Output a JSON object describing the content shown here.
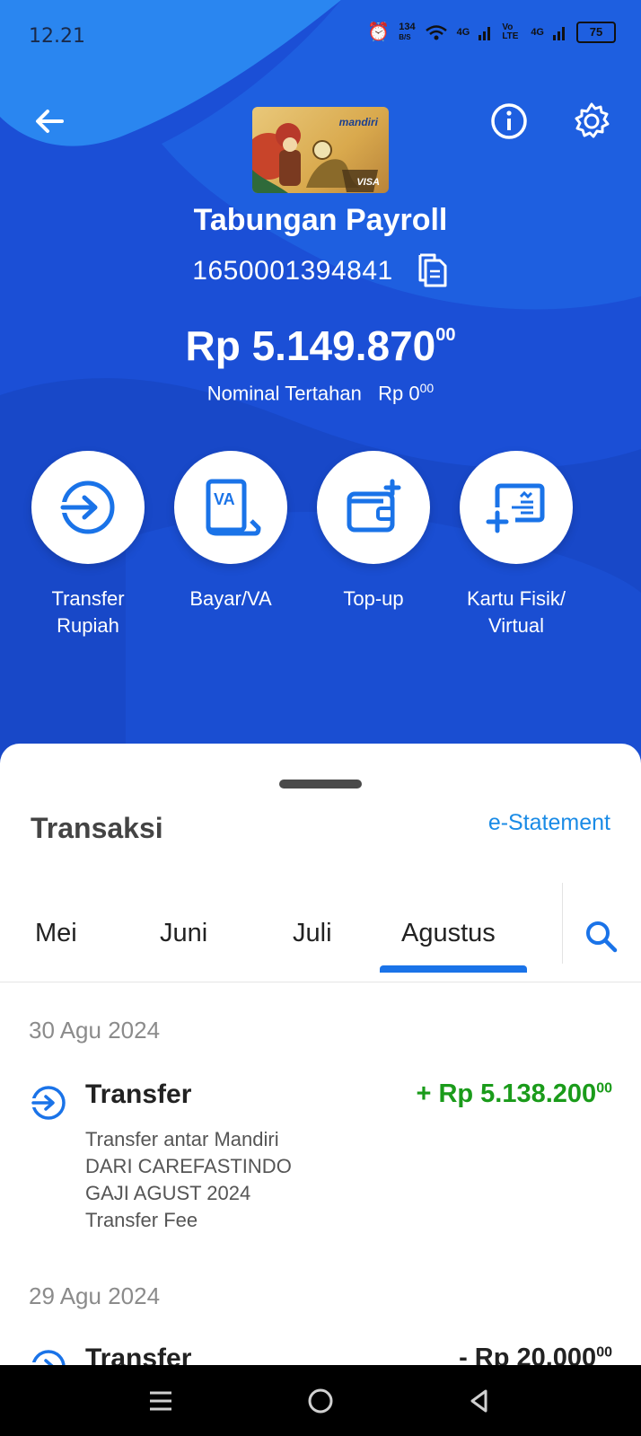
{
  "status_bar": {
    "time": "12.21",
    "data_speed": "134",
    "data_unit": "B/S",
    "net1": "4G",
    "volte": "Vo LTE",
    "net2": "4G",
    "battery": "75"
  },
  "header": {
    "card_brand": "mandiri",
    "card_network": "VISA",
    "account_name": "Tabungan Payroll",
    "account_number": "1650001394841",
    "balance_main": "Rp 5.149.870",
    "balance_cents": "00",
    "held_label": "Nominal Tertahan",
    "held_amount": "Rp 0",
    "held_cents": "00"
  },
  "actions": [
    {
      "label_line1": "Transfer",
      "label_line2": "Rupiah",
      "icon": "transfer-icon"
    },
    {
      "label_line1": "Bayar/VA",
      "label_line2": "",
      "icon": "va-icon"
    },
    {
      "label_line1": "Top-up",
      "label_line2": "",
      "icon": "wallet-plus-icon"
    },
    {
      "label_line1": "Kartu Fisik/",
      "label_line2": "Virtual",
      "icon": "card-plus-icon"
    }
  ],
  "transactions": {
    "title": "Transaksi",
    "estatement": "e-Statement",
    "tabs": [
      "Mei",
      "Juni",
      "Juli",
      "Agustus"
    ],
    "active_tab": "Agustus",
    "groups": [
      {
        "date": "30 Agu 2024",
        "items": [
          {
            "title": "Transfer",
            "amount": "+ Rp 5.138.200",
            "cents": "00",
            "desc": [
              "Transfer antar Mandiri",
              "DARI CAREFASTINDO",
              "GAJI AGUST 2024",
              "Transfer Fee"
            ]
          }
        ]
      },
      {
        "date": "29 Agu 2024",
        "items": [
          {
            "title": "Transfer",
            "amount": "- Rp 20.000",
            "cents": "00",
            "desc": []
          }
        ]
      }
    ]
  },
  "colors": {
    "primary": "#1b4fd6",
    "accent": "#1a73e8",
    "credit": "#1a9b1a",
    "debit": "#222222"
  }
}
